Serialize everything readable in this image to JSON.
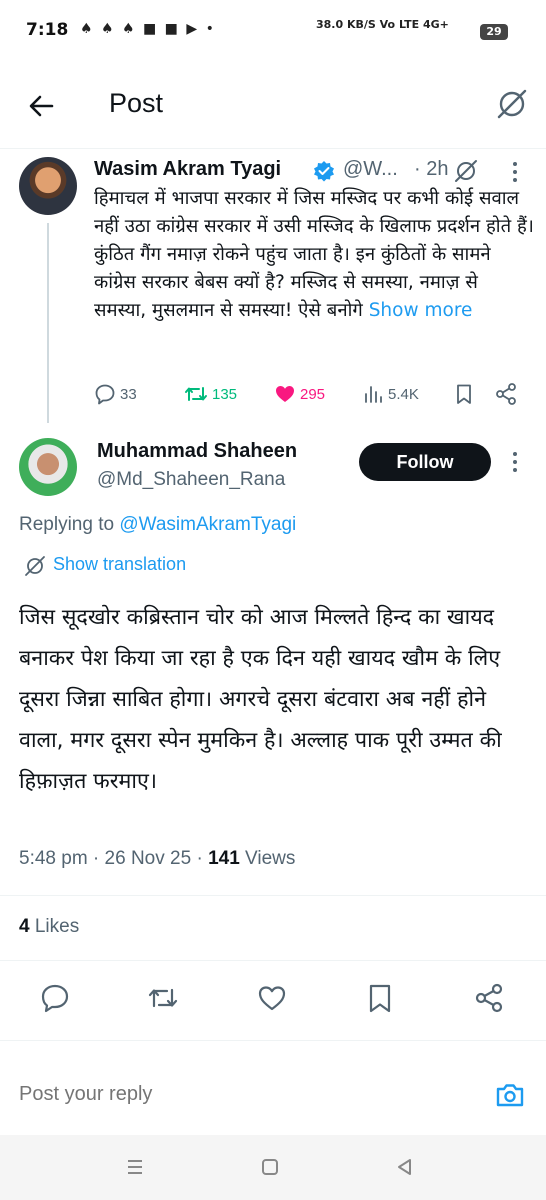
{
  "status_bar": {
    "time": "7:18",
    "left_icons": "♠ ♠ ♠ ■ ■ ▶ •",
    "network": "38.0 KB/S  Vo LTE  4G+",
    "battery": "29"
  },
  "header": {
    "title": "Post"
  },
  "parent_tweet": {
    "name": "Wasim Akram Tyagi",
    "handle": "@W...",
    "time": "· 2h",
    "text": "हिमाचल में भाजपा सरकार में जिस मस्जिद पर कभी कोई सवाल नहीं उठा कांग्रेस सरकार में उसी मस्जिद के खिलाफ प्रदर्शन होते हैं। कुंठित गैंग नमाज़ रोकने पहुंच जाता है। इन कुंठितों के सामने कांग्रेस सरकार बेबस क्यों है? मस्जिद से समस्या, नमाज़ से समस्या, मुसलमान से समस्या! ऐसे बनोगे",
    "show_more": "Show more",
    "replies": "33",
    "reposts": "135",
    "likes": "295",
    "views": "5.4K",
    "colors": {
      "repost": "#00ba7c",
      "like": "#f91880",
      "link": "#1d9bf0"
    }
  },
  "reply_tweet": {
    "name": "Muhammad Shaheen",
    "handle": "@Md_Shaheen_Rana",
    "follow_label": "Follow",
    "replying_prefix": "Replying to",
    "replying_to": "@WasimAkramTyagi",
    "translate_label": "Show translation",
    "text": "जिस सूदखोर कब्रिस्तान चोर को आज मिल्लते हिन्द का खायद बनाकर पेश किया जा रहा है एक दिन यही खायद खौम के लिए दूसरा जिन्ना साबित होगा। अगरचे दूसरा बंटवारा अब नहीं होने वाला, मगर दूसरा स्पेन मुमकिन है। अल्लाह पाक पूरी उम्मत की हिफ़ाज़त फरमाए।",
    "time": "5:48 pm",
    "date": "26 Nov 25",
    "views_count": "141",
    "views_label": "Views",
    "likes_count": "4",
    "likes_label": "Likes"
  },
  "composer": {
    "placeholder": "Post your reply"
  }
}
